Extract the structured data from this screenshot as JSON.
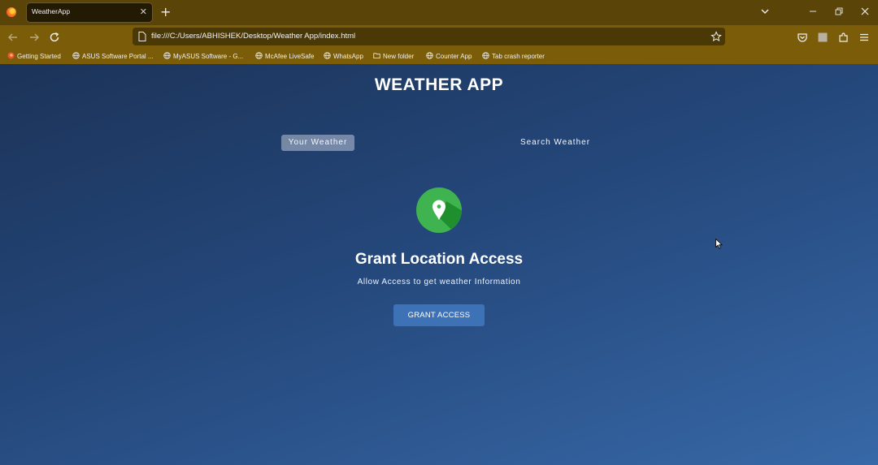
{
  "browser": {
    "tab": {
      "title": "WeatherApp",
      "close_glyph": "✕"
    },
    "new_tab_glyph": "+",
    "url": "file:///C:/Users/ABHISHEK/Desktop/Weather App/index.html",
    "bookmarks": [
      {
        "label": "Getting Started",
        "icon": "firefox-icon"
      },
      {
        "label": "ASUS Software Portal ...",
        "icon": "globe-icon"
      },
      {
        "label": "MyASUS Software - G...",
        "icon": "globe-icon"
      },
      {
        "label": "McAfee LiveSafe",
        "icon": "globe-icon"
      },
      {
        "label": "WhatsApp",
        "icon": "globe-icon"
      },
      {
        "label": "New folder",
        "icon": "folder-icon"
      },
      {
        "label": "Counter App",
        "icon": "globe-icon"
      },
      {
        "label": "Tab crash reporter",
        "icon": "globe-icon"
      }
    ]
  },
  "app": {
    "title": "WEATHER APP",
    "tabs": {
      "your_weather": "Your Weather",
      "search_weather": "Search Weather"
    },
    "grant": {
      "title": "Grant Location Access",
      "subtitle": "Allow Access to get weather Information",
      "button": "GRANT ACCESS"
    }
  },
  "colors": {
    "chrome_tabbar": "#5b4407",
    "chrome_toolbar": "#7a5c09",
    "accent_button": "#3e72b6",
    "location_icon_green": "#3fb34f"
  }
}
